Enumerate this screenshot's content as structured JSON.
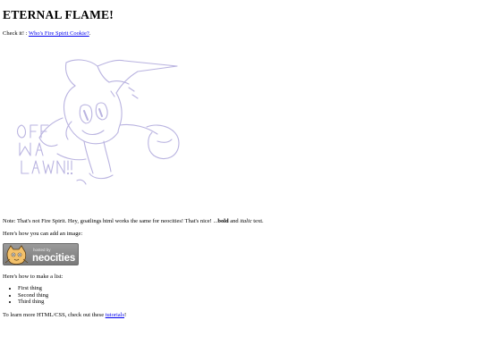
{
  "page": {
    "title": "ETERNAL FLAME!",
    "check_prefix": "Check it! :",
    "check_link": "Who's Fire Spirit Cookie?",
    "check_suffix": ".",
    "drawing_text": [
      "OFF",
      "MA",
      "LAWN!!"
    ],
    "note_text": "Note: That's not Fire Spirit. Hey, goatlings html works the same for neocities! That's nice! ...",
    "note_bold": "bold",
    "note_and": " and ",
    "note_italic": "italic",
    "note_end": " text.",
    "image_intro": "Here's how you can add an image:",
    "badge": {
      "small": "hosted by",
      "big": "neocities"
    },
    "list_intro": "Here's how to make a list:",
    "list_items": [
      "First thing",
      "Second thing",
      "Third thing"
    ],
    "learn_prefix": "To learn more HTML/CSS, check out these ",
    "learn_link": "tutorials",
    "learn_suffix": "!"
  },
  "colors": {
    "link": "#0000ee",
    "drawing": "#b9b3e0"
  }
}
